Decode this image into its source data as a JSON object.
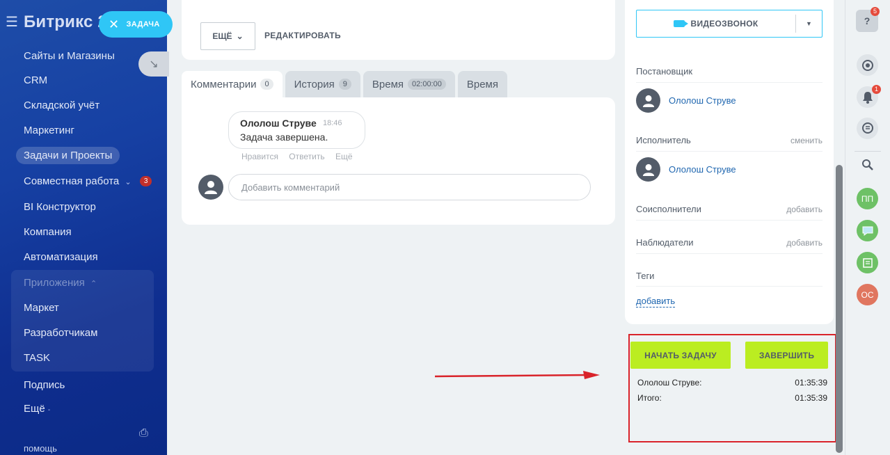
{
  "sidebar": {
    "logo": "Битрикс 2",
    "task_pill": "ЗАДАЧА",
    "items": [
      {
        "label": "Сайты и Магазины"
      },
      {
        "label": "CRM"
      },
      {
        "label": "Складской учёт"
      },
      {
        "label": "Маркетинг"
      },
      {
        "label": "Задачи и Проекты"
      },
      {
        "label": "Совместная работа",
        "badge": "3"
      },
      {
        "label": "BI Конструктор"
      },
      {
        "label": "Компания"
      },
      {
        "label": "Автоматизация"
      },
      {
        "label": "Приложения"
      },
      {
        "label": "Маркет"
      },
      {
        "label": "Разработчикам"
      },
      {
        "label": "TASK"
      },
      {
        "label": "Подпись"
      },
      {
        "label": "Ещё"
      }
    ],
    "help": "помощь"
  },
  "toolbar_top": {
    "more_label": "ЕЩЁ",
    "edit_label": "РЕДАКТИРОВАТЬ"
  },
  "tabs": [
    {
      "label": "Комментарии",
      "count": "0"
    },
    {
      "label": "История",
      "count": "9"
    },
    {
      "label": "Время",
      "count": "02:00:00"
    },
    {
      "label": "Время"
    }
  ],
  "comment": {
    "author": "Ололош Струве",
    "time": "18:46",
    "text": "Задача завершена.",
    "actions": [
      "Нравится",
      "Ответить",
      "Ещё"
    ],
    "input_placeholder": "Добавить комментарий"
  },
  "right_panel": {
    "video_call": "ВИДЕОЗВОНОК",
    "creator_label": "Постановщик",
    "creator_name": "Ололош Струве",
    "assignee_label": "Исполнитель",
    "assignee_change": "сменить",
    "assignee_name": "Ололош Струве",
    "coexecutors_label": "Соисполнители",
    "coexecutors_add": "добавить",
    "observers_label": "Наблюдатели",
    "observers_add": "добавить",
    "tags_label": "Теги",
    "tags_add": "добавить"
  },
  "timer": {
    "start_button": "НАЧАТЬ ЗАДАЧУ",
    "finish_button": "ЗАВЕРШИТЬ",
    "rows": [
      {
        "label": "Ололош Струве:",
        "value": "01:35:39"
      },
      {
        "label": "Итого:",
        "value": "01:35:39"
      }
    ]
  },
  "right_toolbar": {
    "help_badge": "5",
    "notify_badge": "1",
    "avatars": [
      {
        "initials": "ПП",
        "color": "#6ec166"
      },
      {
        "initials": "ОС",
        "color": "#e0765f"
      }
    ]
  },
  "colors": {
    "accent_green": "#bbed21",
    "link_blue": "#2067b0",
    "highlight_red": "#d9232a",
    "video_blue": "#2fc6f6"
  }
}
